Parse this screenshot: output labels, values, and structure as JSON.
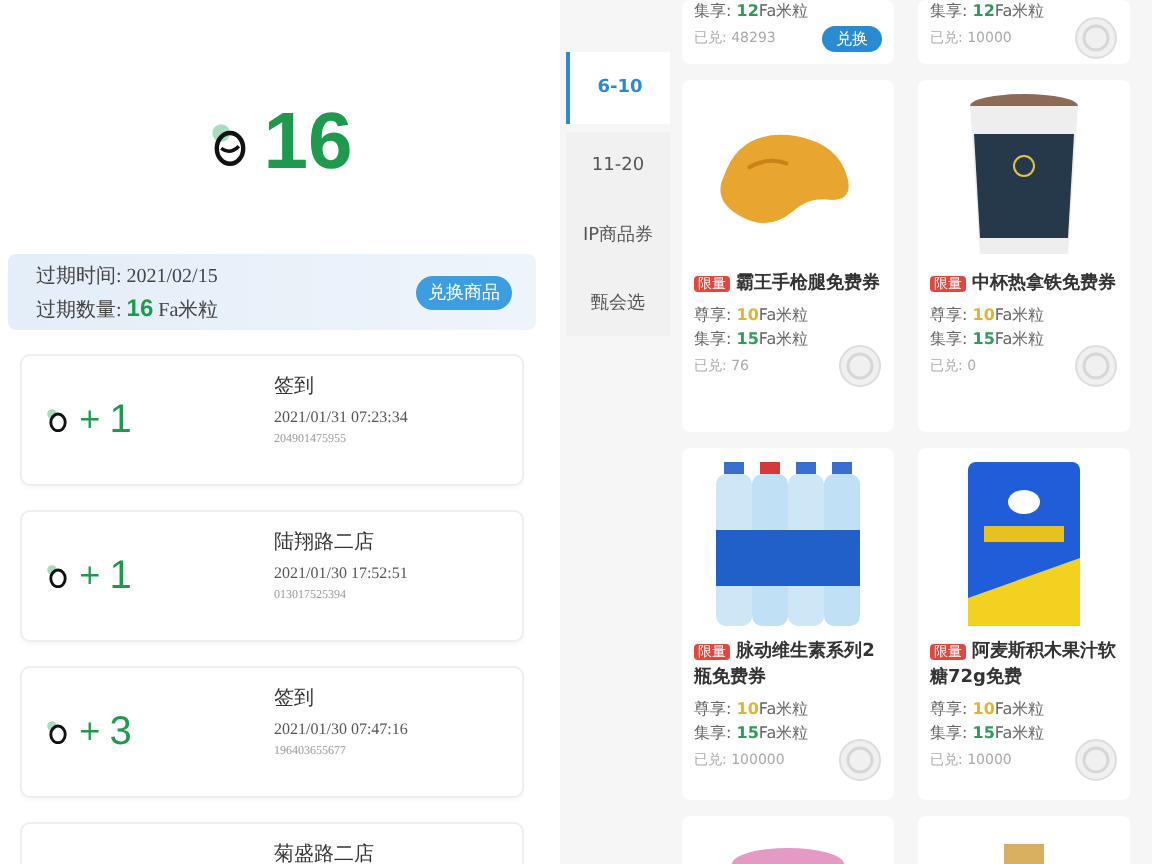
{
  "balance": {
    "amount": "16"
  },
  "expiry": {
    "date_label": "过期时间:",
    "date": "2021/02/15",
    "amount_label": "过期数量:",
    "amount": "16",
    "unit": "Fa米粒",
    "button": "兑换商品"
  },
  "records": [
    {
      "sign": "+",
      "amount": "1",
      "title": "签到",
      "time": "2021/01/31 07:23:34",
      "code": "204901475955"
    },
    {
      "sign": "+",
      "amount": "1",
      "title": "陆翔路二店",
      "time": "2021/01/30 17:52:51",
      "code": "013017525394"
    },
    {
      "sign": "+",
      "amount": "3",
      "title": "签到",
      "time": "2021/01/30 07:47:16",
      "code": "196403655677"
    },
    {
      "title": "菊盛路二店"
    }
  ],
  "sidebar": {
    "items": [
      {
        "label": "6-10",
        "selected": true
      },
      {
        "label": "11-20",
        "selected": false
      },
      {
        "label": "IP商品券",
        "selected": false
      },
      {
        "label": "甄会选",
        "selected": false
      }
    ]
  },
  "products": [
    {
      "kind": "partial",
      "prices": [
        {
          "kind": "member",
          "label": "集享:",
          "amount": "12",
          "unit": "Fa米粒"
        }
      ],
      "redeemed": "已兑: 48293",
      "button": "兑换"
    },
    {
      "kind": "partial",
      "prices": [
        {
          "kind": "member",
          "label": "集享:",
          "amount": "12",
          "unit": "Fa米粒"
        }
      ],
      "redeemed": "已兑: 10000"
    },
    {
      "kind": "full",
      "tag": "限量",
      "name": "霸王手枪腿免费券",
      "prices": [
        {
          "kind": "vip",
          "label": "尊享:",
          "amount": "10",
          "unit": "Fa米粒"
        },
        {
          "kind": "member",
          "label": "集享:",
          "amount": "15",
          "unit": "Fa米粒"
        }
      ],
      "redeemed": "已兑: 76"
    },
    {
      "kind": "full",
      "tag": "限量",
      "name": "中杯热拿铁免费券",
      "prices": [
        {
          "kind": "vip",
          "label": "尊享:",
          "amount": "10",
          "unit": "Fa米粒"
        },
        {
          "kind": "member",
          "label": "集享:",
          "amount": "15",
          "unit": "Fa米粒"
        }
      ],
      "redeemed": "已兑: 0"
    },
    {
      "kind": "full",
      "tag": "限量",
      "name": "脉动维生素系列2瓶免费券",
      "prices": [
        {
          "kind": "vip",
          "label": "尊享:",
          "amount": "10",
          "unit": "Fa米粒"
        },
        {
          "kind": "member",
          "label": "集享:",
          "amount": "15",
          "unit": "Fa米粒"
        }
      ],
      "redeemed": "已兑: 100000"
    },
    {
      "kind": "full",
      "tag": "限量",
      "name": "阿麦斯积木果汁软糖72g免费",
      "prices": [
        {
          "kind": "vip",
          "label": "尊享:",
          "amount": "10",
          "unit": "Fa米粒"
        },
        {
          "kind": "member",
          "label": "集享:",
          "amount": "15",
          "unit": "Fa米粒"
        }
      ],
      "redeemed": "已兑: 10000"
    },
    {
      "kind": "top"
    },
    {
      "kind": "top"
    }
  ]
}
